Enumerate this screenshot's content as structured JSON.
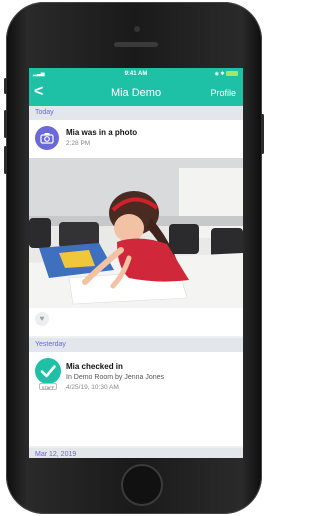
{
  "status_bar": {
    "time": "9:41 AM"
  },
  "nav": {
    "back": "<",
    "title": "Mia Demo",
    "profile_link": "Profile"
  },
  "sections": {
    "today": "Today",
    "yesterday": "Yesterday",
    "mar12": "Mar 12, 2019"
  },
  "photo_post": {
    "title": "Mia was in a photo",
    "time": "2:28 PM",
    "like_icon": "heart-icon"
  },
  "checkin_post": {
    "title": "Mia checked in",
    "detail": "In Demo Room by Jenna  Jones",
    "datetime": "4/25/19, 10:30 AM",
    "badge": "STAFF"
  },
  "colors": {
    "accent": "#1fc1a6",
    "camera_circle": "#6b69d6",
    "section_text": "#6a6ad8"
  }
}
